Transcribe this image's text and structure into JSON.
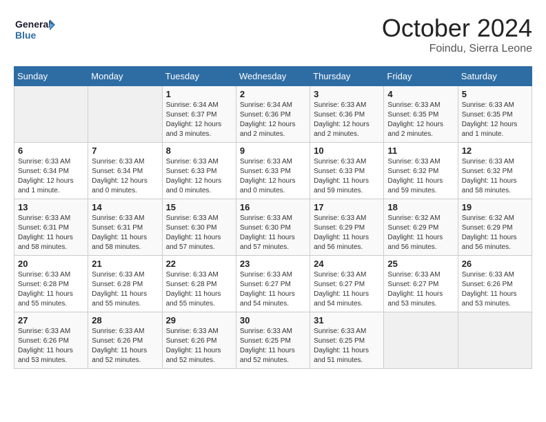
{
  "logo": {
    "line1": "General",
    "line2": "Blue"
  },
  "title": "October 2024",
  "subtitle": "Foindu, Sierra Leone",
  "days_of_week": [
    "Sunday",
    "Monday",
    "Tuesday",
    "Wednesday",
    "Thursday",
    "Friday",
    "Saturday"
  ],
  "weeks": [
    [
      {
        "day": "",
        "info": ""
      },
      {
        "day": "",
        "info": ""
      },
      {
        "day": "1",
        "info": "Sunrise: 6:34 AM\nSunset: 6:37 PM\nDaylight: 12 hours and 3 minutes."
      },
      {
        "day": "2",
        "info": "Sunrise: 6:34 AM\nSunset: 6:36 PM\nDaylight: 12 hours and 2 minutes."
      },
      {
        "day": "3",
        "info": "Sunrise: 6:33 AM\nSunset: 6:36 PM\nDaylight: 12 hours and 2 minutes."
      },
      {
        "day": "4",
        "info": "Sunrise: 6:33 AM\nSunset: 6:35 PM\nDaylight: 12 hours and 2 minutes."
      },
      {
        "day": "5",
        "info": "Sunrise: 6:33 AM\nSunset: 6:35 PM\nDaylight: 12 hours and 1 minute."
      }
    ],
    [
      {
        "day": "6",
        "info": "Sunrise: 6:33 AM\nSunset: 6:34 PM\nDaylight: 12 hours and 1 minute."
      },
      {
        "day": "7",
        "info": "Sunrise: 6:33 AM\nSunset: 6:34 PM\nDaylight: 12 hours and 0 minutes."
      },
      {
        "day": "8",
        "info": "Sunrise: 6:33 AM\nSunset: 6:33 PM\nDaylight: 12 hours and 0 minutes."
      },
      {
        "day": "9",
        "info": "Sunrise: 6:33 AM\nSunset: 6:33 PM\nDaylight: 12 hours and 0 minutes."
      },
      {
        "day": "10",
        "info": "Sunrise: 6:33 AM\nSunset: 6:33 PM\nDaylight: 11 hours and 59 minutes."
      },
      {
        "day": "11",
        "info": "Sunrise: 6:33 AM\nSunset: 6:32 PM\nDaylight: 11 hours and 59 minutes."
      },
      {
        "day": "12",
        "info": "Sunrise: 6:33 AM\nSunset: 6:32 PM\nDaylight: 11 hours and 58 minutes."
      }
    ],
    [
      {
        "day": "13",
        "info": "Sunrise: 6:33 AM\nSunset: 6:31 PM\nDaylight: 11 hours and 58 minutes."
      },
      {
        "day": "14",
        "info": "Sunrise: 6:33 AM\nSunset: 6:31 PM\nDaylight: 11 hours and 58 minutes."
      },
      {
        "day": "15",
        "info": "Sunrise: 6:33 AM\nSunset: 6:30 PM\nDaylight: 11 hours and 57 minutes."
      },
      {
        "day": "16",
        "info": "Sunrise: 6:33 AM\nSunset: 6:30 PM\nDaylight: 11 hours and 57 minutes."
      },
      {
        "day": "17",
        "info": "Sunrise: 6:33 AM\nSunset: 6:29 PM\nDaylight: 11 hours and 56 minutes."
      },
      {
        "day": "18",
        "info": "Sunrise: 6:32 AM\nSunset: 6:29 PM\nDaylight: 11 hours and 56 minutes."
      },
      {
        "day": "19",
        "info": "Sunrise: 6:32 AM\nSunset: 6:29 PM\nDaylight: 11 hours and 56 minutes."
      }
    ],
    [
      {
        "day": "20",
        "info": "Sunrise: 6:33 AM\nSunset: 6:28 PM\nDaylight: 11 hours and 55 minutes."
      },
      {
        "day": "21",
        "info": "Sunrise: 6:33 AM\nSunset: 6:28 PM\nDaylight: 11 hours and 55 minutes."
      },
      {
        "day": "22",
        "info": "Sunrise: 6:33 AM\nSunset: 6:28 PM\nDaylight: 11 hours and 55 minutes."
      },
      {
        "day": "23",
        "info": "Sunrise: 6:33 AM\nSunset: 6:27 PM\nDaylight: 11 hours and 54 minutes."
      },
      {
        "day": "24",
        "info": "Sunrise: 6:33 AM\nSunset: 6:27 PM\nDaylight: 11 hours and 54 minutes."
      },
      {
        "day": "25",
        "info": "Sunrise: 6:33 AM\nSunset: 6:27 PM\nDaylight: 11 hours and 53 minutes."
      },
      {
        "day": "26",
        "info": "Sunrise: 6:33 AM\nSunset: 6:26 PM\nDaylight: 11 hours and 53 minutes."
      }
    ],
    [
      {
        "day": "27",
        "info": "Sunrise: 6:33 AM\nSunset: 6:26 PM\nDaylight: 11 hours and 53 minutes."
      },
      {
        "day": "28",
        "info": "Sunrise: 6:33 AM\nSunset: 6:26 PM\nDaylight: 11 hours and 52 minutes."
      },
      {
        "day": "29",
        "info": "Sunrise: 6:33 AM\nSunset: 6:26 PM\nDaylight: 11 hours and 52 minutes."
      },
      {
        "day": "30",
        "info": "Sunrise: 6:33 AM\nSunset: 6:25 PM\nDaylight: 11 hours and 52 minutes."
      },
      {
        "day": "31",
        "info": "Sunrise: 6:33 AM\nSunset: 6:25 PM\nDaylight: 11 hours and 51 minutes."
      },
      {
        "day": "",
        "info": ""
      },
      {
        "day": "",
        "info": ""
      }
    ]
  ]
}
